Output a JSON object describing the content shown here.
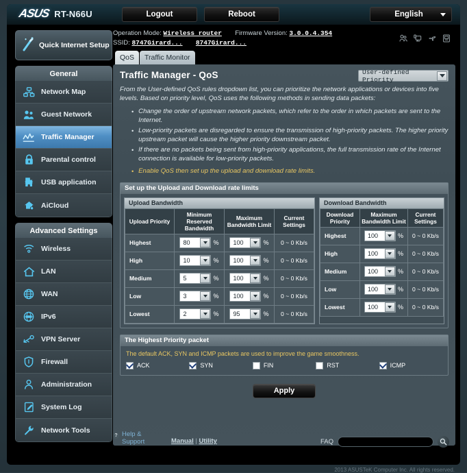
{
  "topbar": {
    "brand": "ASUS",
    "model": "RT-N66U",
    "logout_label": "Logout",
    "reboot_label": "Reboot",
    "language": "English"
  },
  "info": {
    "operation_mode_label": "Operation Mode:",
    "operation_mode_value": "Wireless router",
    "firmware_label": "Firmware Version:",
    "firmware_value": "3.0.0.4.354",
    "ssid_label": "SSID:",
    "ssid_1": "8747Girard...",
    "ssid_2": "8747Girard...",
    "status_icons": [
      "guest-network-icon",
      "clients-icon",
      "usb-icon",
      "printer-icon"
    ]
  },
  "tabs": [
    {
      "label": "QoS",
      "active": true
    },
    {
      "label": "Traffic Monitor",
      "active": false
    }
  ],
  "sidebar": {
    "quick_setup": "Quick Internet Setup",
    "general_header": "General",
    "general_items": [
      {
        "label": "Network Map",
        "icon": "network-map-icon",
        "active": false
      },
      {
        "label": "Guest Network",
        "icon": "guest-network-icon",
        "active": false
      },
      {
        "label": "Traffic Manager",
        "icon": "traffic-manager-icon",
        "active": true
      },
      {
        "label": "Parental control",
        "icon": "lock-icon",
        "active": false
      },
      {
        "label": "USB application",
        "icon": "puzzle-icon",
        "active": false
      },
      {
        "label": "AiCloud",
        "icon": "cloud-home-icon",
        "active": false
      }
    ],
    "advanced_header": "Advanced Settings",
    "advanced_items": [
      {
        "label": "Wireless",
        "icon": "wifi-icon",
        "active": false
      },
      {
        "label": "LAN",
        "icon": "home-icon",
        "active": false
      },
      {
        "label": "WAN",
        "icon": "globe-icon",
        "active": false
      },
      {
        "label": "IPv6",
        "icon": "ipv6-globe-icon",
        "active": false
      },
      {
        "label": "VPN Server",
        "icon": "vpn-key-icon",
        "active": false
      },
      {
        "label": "Firewall",
        "icon": "shield-icon",
        "active": false
      },
      {
        "label": "Administration",
        "icon": "user-icon",
        "active": false
      },
      {
        "label": "System Log",
        "icon": "document-pencil-icon",
        "active": false
      },
      {
        "label": "Network Tools",
        "icon": "wrench-icon",
        "active": false
      }
    ]
  },
  "main": {
    "page_title": "Traffic Manager - QoS",
    "rules_dropdown_value": "User-defined Priority",
    "intro": "From the User-defined QoS rules dropdown list, you can prioritize the network applications or devices into five levels. Based on priority level, QoS uses the following methods in sending data packets:",
    "bullets": [
      "Change the order of upstream network packets, which refer to the order in which packets are sent to the Internet.",
      "Low-priority packets are disregarded to ensure the transmission of high-priority packets. The higher priority upstream packet will cause the higher priority downstream packet.",
      "If there are no packets being sent from high-priority applications, the full transmission rate of the Internet connection is available for low-priority packets."
    ],
    "highlight_bullet": "Enable QoS then set up the upload and download rate limits.",
    "rate_section_title": "Set up the Upload and Download rate limits",
    "upload": {
      "title": "Upload Bandwidth",
      "headers": [
        "Upload Priority",
        "Minimum Reserved Bandwidth",
        "Maximum Bandwidth Limit",
        "Current Settings"
      ],
      "rows": [
        {
          "priority": "Highest",
          "min_reserved": "80",
          "max_limit": "100",
          "current": "0 ~ 0 Kb/s"
        },
        {
          "priority": "High",
          "min_reserved": "10",
          "max_limit": "100",
          "current": "0 ~ 0 Kb/s"
        },
        {
          "priority": "Medium",
          "min_reserved": "5",
          "max_limit": "100",
          "current": "0 ~ 0 Kb/s"
        },
        {
          "priority": "Low",
          "min_reserved": "3",
          "max_limit": "100",
          "current": "0 ~ 0 Kb/s"
        },
        {
          "priority": "Lowest",
          "min_reserved": "2",
          "max_limit": "95",
          "current": "0 ~ 0 Kb/s"
        }
      ],
      "percent_symbol": "%"
    },
    "download": {
      "title": "Download Bandwidth",
      "headers": [
        "Download Priority",
        "Maximum Bandwidth Limit",
        "Current Settings"
      ],
      "rows": [
        {
          "priority": "Highest",
          "max_limit": "100",
          "current": "0 ~ 0 Kb/s"
        },
        {
          "priority": "High",
          "max_limit": "100",
          "current": "0 ~ 0 Kb/s"
        },
        {
          "priority": "Medium",
          "max_limit": "100",
          "current": "0 ~ 0 Kb/s"
        },
        {
          "priority": "Low",
          "max_limit": "100",
          "current": "0 ~ 0 Kb/s"
        },
        {
          "priority": "Lowest",
          "max_limit": "100",
          "current": "0 ~ 0 Kb/s"
        }
      ],
      "percent_symbol": "%"
    },
    "priority_packet": {
      "title": "The Highest Priority packet",
      "note": "The default ACK, SYN and ICMP packets are used to improve the game smoothness.",
      "checkboxes": [
        {
          "label": "ACK",
          "checked": true
        },
        {
          "label": "SYN",
          "checked": true
        },
        {
          "label": "FIN",
          "checked": false
        },
        {
          "label": "RST",
          "checked": false
        },
        {
          "label": "ICMP",
          "checked": true
        }
      ]
    },
    "apply_label": "Apply"
  },
  "footer": {
    "help_line1": "Help &",
    "help_line2": "Support",
    "manual": "Manual",
    "separator": "|",
    "utility": "Utility",
    "faq_label": "FAQ",
    "faq_placeholder": "",
    "copyright": "2013 ASUSTeK Computer Inc. All rights reserved."
  },
  "colors": {
    "accent_blue": "#4f8fc4",
    "highlight_yellow": "#e8c662",
    "panel_bg": "#45535b",
    "frame_black": "#000000"
  }
}
